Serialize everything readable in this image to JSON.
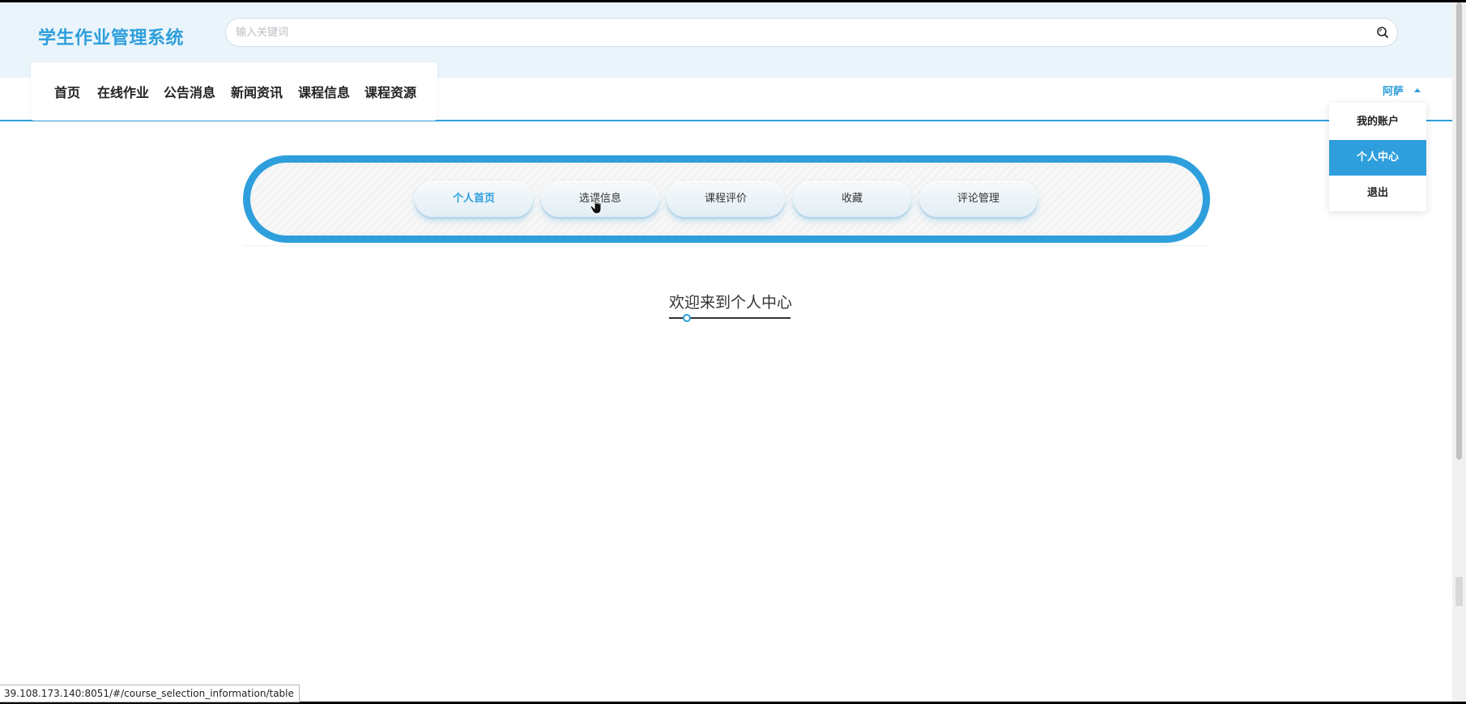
{
  "header": {
    "title": "学生作业管理系统",
    "search_placeholder": "输入关键词"
  },
  "nav": {
    "items": [
      {
        "label": "首页"
      },
      {
        "label": "在线作业"
      },
      {
        "label": "公告消息"
      },
      {
        "label": "新闻资讯"
      },
      {
        "label": "课程信息"
      },
      {
        "label": "课程资源"
      }
    ]
  },
  "user": {
    "name": "阿萨",
    "menu": [
      {
        "label": "我的账户",
        "active": false
      },
      {
        "label": "个人中心",
        "active": true
      },
      {
        "label": "退出",
        "active": false
      }
    ]
  },
  "center_tabs": [
    {
      "label": "个人首页",
      "active": true
    },
    {
      "label": "选课信息",
      "active": false
    },
    {
      "label": "课程评价",
      "active": false
    },
    {
      "label": "收藏",
      "active": false
    },
    {
      "label": "评论管理",
      "active": false
    }
  ],
  "welcome": {
    "title": "欢迎来到个人中心"
  },
  "status_bar": {
    "url": "39.108.173.140:8051/#/course_selection_information/table"
  },
  "colors": {
    "accent": "#2e9fdc",
    "header_bg": "#eaf4fb"
  },
  "icons": {
    "search": "search-icon",
    "caret": "caret-up-icon",
    "cursor": "hand-cursor-icon"
  }
}
